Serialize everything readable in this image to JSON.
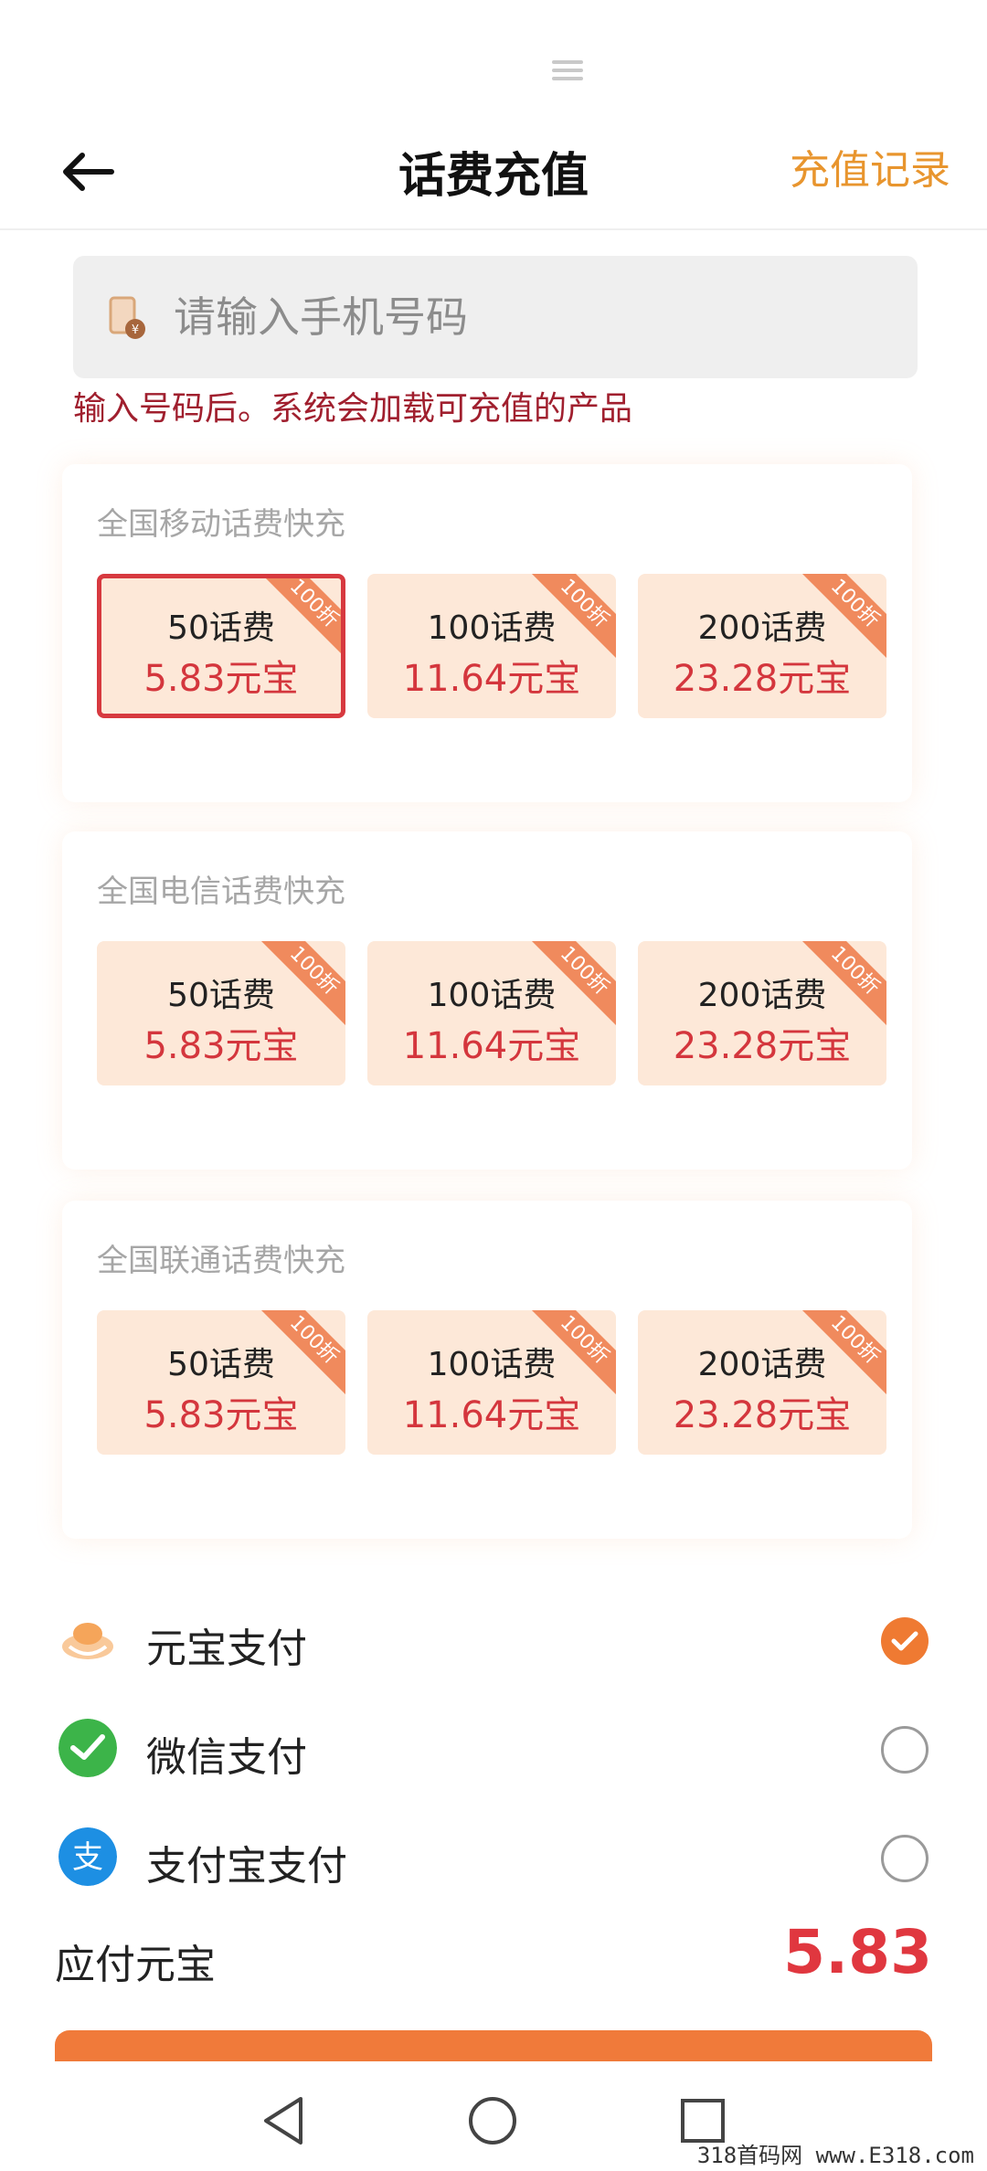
{
  "header": {
    "title": "话费充值",
    "history_label": "充值记录"
  },
  "phone_input": {
    "placeholder": "请输入手机号码",
    "value": ""
  },
  "hint": "输入号码后。系统会加载可充值的产品",
  "sections": [
    {
      "title": "全国移动话费快充",
      "cards": [
        {
          "face": "50话费",
          "price": "5.83元宝",
          "badge": "100折",
          "selected": true
        },
        {
          "face": "100话费",
          "price": "11.64元宝",
          "badge": "100折",
          "selected": false
        },
        {
          "face": "200话费",
          "price": "23.28元宝",
          "badge": "100折",
          "selected": false
        }
      ]
    },
    {
      "title": "全国电信话费快充",
      "cards": [
        {
          "face": "50话费",
          "price": "5.83元宝",
          "badge": "100折",
          "selected": false
        },
        {
          "face": "100话费",
          "price": "11.64元宝",
          "badge": "100折",
          "selected": false
        },
        {
          "face": "200话费",
          "price": "23.28元宝",
          "badge": "100折",
          "selected": false
        }
      ]
    },
    {
      "title": "全国联通话费快充",
      "cards": [
        {
          "face": "50话费",
          "price": "5.83元宝",
          "badge": "100折",
          "selected": false
        },
        {
          "face": "100话费",
          "price": "11.64元宝",
          "badge": "100折",
          "selected": false
        },
        {
          "face": "200话费",
          "price": "23.28元宝",
          "badge": "100折",
          "selected": false
        }
      ]
    }
  ],
  "payment": {
    "methods": [
      {
        "label": "元宝支付",
        "icon": "yuanbao-icon",
        "checked": true
      },
      {
        "label": "微信支付",
        "icon": "wechat-icon",
        "checked": false
      },
      {
        "label": "支付宝支付",
        "icon": "alipay-icon",
        "checked": false
      }
    ],
    "total_label": "应付元宝",
    "total_value": "5.83"
  },
  "watermark": "318首码网  www.E318.com",
  "colors": {
    "accent": "#ef7a32",
    "price_red": "#d4363d",
    "link_orange": "#e8952e",
    "hint_red": "#a01f2e",
    "card_bg": "#fde8d8"
  }
}
